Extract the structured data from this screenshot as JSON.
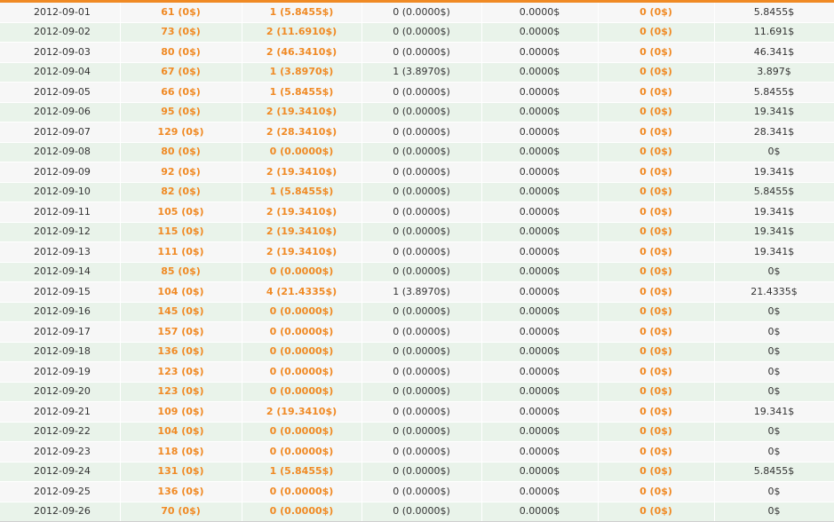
{
  "accent_color": "#f08a24",
  "stats_table": {
    "rows": [
      [
        "2012-09-01",
        "61 (0$)",
        "1 (5.8455$)",
        "0 (0.0000$)",
        "0.0000$",
        "0 (0$)",
        "5.8455$"
      ],
      [
        "2012-09-02",
        "73 (0$)",
        "2 (11.6910$)",
        "0 (0.0000$)",
        "0.0000$",
        "0 (0$)",
        "11.691$"
      ],
      [
        "2012-09-03",
        "80 (0$)",
        "2 (46.3410$)",
        "0 (0.0000$)",
        "0.0000$",
        "0 (0$)",
        "46.341$"
      ],
      [
        "2012-09-04",
        "67 (0$)",
        "1 (3.8970$)",
        "1 (3.8970$)",
        "0.0000$",
        "0 (0$)",
        "3.897$"
      ],
      [
        "2012-09-05",
        "66 (0$)",
        "1 (5.8455$)",
        "0 (0.0000$)",
        "0.0000$",
        "0 (0$)",
        "5.8455$"
      ],
      [
        "2012-09-06",
        "95 (0$)",
        "2 (19.3410$)",
        "0 (0.0000$)",
        "0.0000$",
        "0 (0$)",
        "19.341$"
      ],
      [
        "2012-09-07",
        "129 (0$)",
        "2 (28.3410$)",
        "0 (0.0000$)",
        "0.0000$",
        "0 (0$)",
        "28.341$"
      ],
      [
        "2012-09-08",
        "80 (0$)",
        "0 (0.0000$)",
        "0 (0.0000$)",
        "0.0000$",
        "0 (0$)",
        "0$"
      ],
      [
        "2012-09-09",
        "92 (0$)",
        "2 (19.3410$)",
        "0 (0.0000$)",
        "0.0000$",
        "0 (0$)",
        "19.341$"
      ],
      [
        "2012-09-10",
        "82 (0$)",
        "1 (5.8455$)",
        "0 (0.0000$)",
        "0.0000$",
        "0 (0$)",
        "5.8455$"
      ],
      [
        "2012-09-11",
        "105 (0$)",
        "2 (19.3410$)",
        "0 (0.0000$)",
        "0.0000$",
        "0 (0$)",
        "19.341$"
      ],
      [
        "2012-09-12",
        "115 (0$)",
        "2 (19.3410$)",
        "0 (0.0000$)",
        "0.0000$",
        "0 (0$)",
        "19.341$"
      ],
      [
        "2012-09-13",
        "111 (0$)",
        "2 (19.3410$)",
        "0 (0.0000$)",
        "0.0000$",
        "0 (0$)",
        "19.341$"
      ],
      [
        "2012-09-14",
        "85 (0$)",
        "0 (0.0000$)",
        "0 (0.0000$)",
        "0.0000$",
        "0 (0$)",
        "0$"
      ],
      [
        "2012-09-15",
        "104 (0$)",
        "4 (21.4335$)",
        "1 (3.8970$)",
        "0.0000$",
        "0 (0$)",
        "21.4335$"
      ],
      [
        "2012-09-16",
        "145 (0$)",
        "0 (0.0000$)",
        "0 (0.0000$)",
        "0.0000$",
        "0 (0$)",
        "0$"
      ],
      [
        "2012-09-17",
        "157 (0$)",
        "0 (0.0000$)",
        "0 (0.0000$)",
        "0.0000$",
        "0 (0$)",
        "0$"
      ],
      [
        "2012-09-18",
        "136 (0$)",
        "0 (0.0000$)",
        "0 (0.0000$)",
        "0.0000$",
        "0 (0$)",
        "0$"
      ],
      [
        "2012-09-19",
        "123 (0$)",
        "0 (0.0000$)",
        "0 (0.0000$)",
        "0.0000$",
        "0 (0$)",
        "0$"
      ],
      [
        "2012-09-20",
        "123 (0$)",
        "0 (0.0000$)",
        "0 (0.0000$)",
        "0.0000$",
        "0 (0$)",
        "0$"
      ],
      [
        "2012-09-21",
        "109 (0$)",
        "2 (19.3410$)",
        "0 (0.0000$)",
        "0.0000$",
        "0 (0$)",
        "19.341$"
      ],
      [
        "2012-09-22",
        "104 (0$)",
        "0 (0.0000$)",
        "0 (0.0000$)",
        "0.0000$",
        "0 (0$)",
        "0$"
      ],
      [
        "2012-09-23",
        "118 (0$)",
        "0 (0.0000$)",
        "0 (0.0000$)",
        "0.0000$",
        "0 (0$)",
        "0$"
      ],
      [
        "2012-09-24",
        "131 (0$)",
        "1 (5.8455$)",
        "0 (0.0000$)",
        "0.0000$",
        "0 (0$)",
        "5.8455$"
      ],
      [
        "2012-09-25",
        "136 (0$)",
        "0 (0.0000$)",
        "0 (0.0000$)",
        "0.0000$",
        "0 (0$)",
        "0$"
      ],
      [
        "2012-09-26",
        "70 (0$)",
        "0 (0.0000$)",
        "0 (0.0000$)",
        "0.0000$",
        "0 (0$)",
        "0$"
      ]
    ]
  }
}
